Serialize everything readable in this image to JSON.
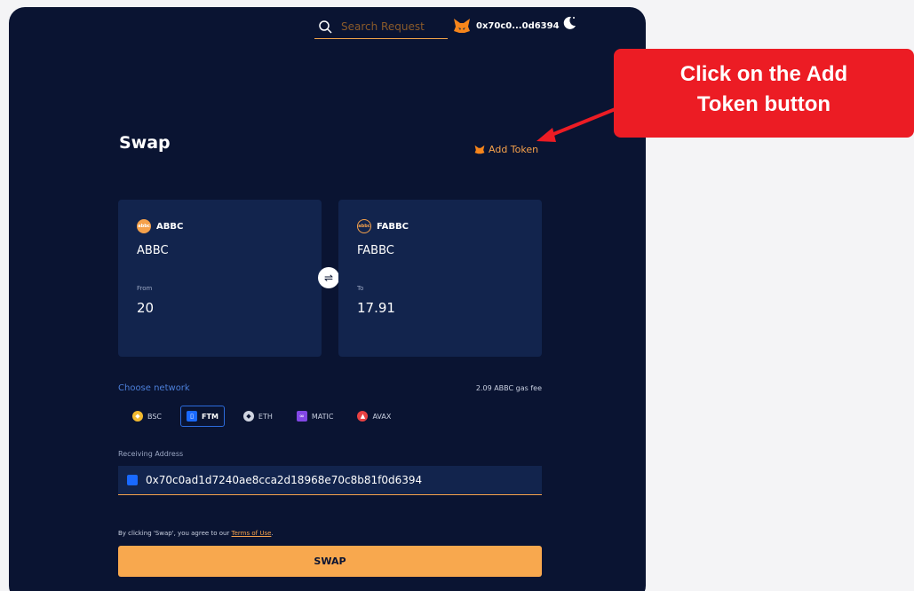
{
  "header": {
    "search_placeholder": "Search Request",
    "wallet_address": "0x70c0...0d6394"
  },
  "swap": {
    "title": "Swap",
    "add_token_label": "Add Token",
    "from": {
      "symbol": "ABBC",
      "name": "ABBC",
      "amount_label": "From",
      "amount": "20",
      "logo_text": "abbc"
    },
    "to": {
      "symbol": "FABBC",
      "name": "FABBC",
      "amount_label": "To",
      "amount": "17.91",
      "logo_text": "abbc"
    }
  },
  "network": {
    "label": "Choose network",
    "gas_fee": "2.09 ABBC gas fee",
    "options": [
      {
        "label": "BSC",
        "active": false
      },
      {
        "label": "FTM",
        "active": true
      },
      {
        "label": "ETH",
        "active": false
      },
      {
        "label": "MATIC",
        "active": false
      },
      {
        "label": "AVAX",
        "active": false
      }
    ]
  },
  "receiving": {
    "label": "Receiving Address",
    "value": "0x70c0ad1d7240ae8cca2d18968e70c8b81f0d6394"
  },
  "terms": {
    "prefix": "By clicking 'Swap', you agree to our ",
    "link": "Terms of Use",
    "suffix": "."
  },
  "swap_button_label": "SWAP",
  "annotation": {
    "text_line1": "Click on the Add",
    "text_line2": "Token button"
  },
  "colors": {
    "background": "#0a1432",
    "card": "#12244d",
    "accent": "#f5a14b",
    "callout": "#ec1c24",
    "link_blue": "#4c7fd9"
  }
}
